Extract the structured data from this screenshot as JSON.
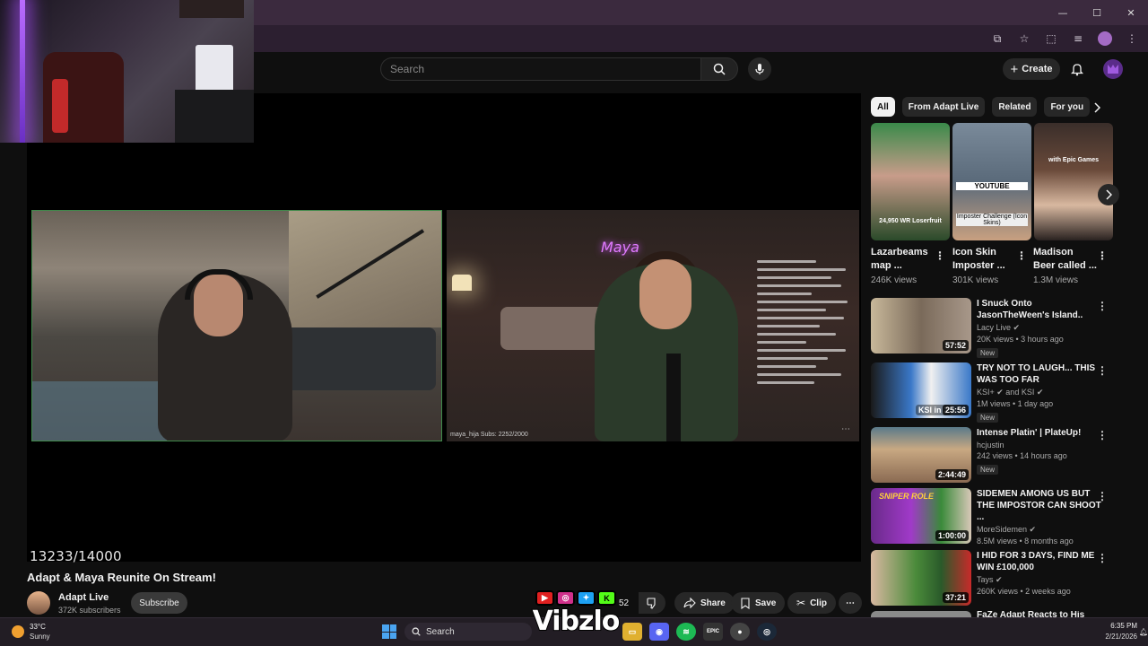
{
  "window": {
    "controls": [
      "—",
      "☐",
      "✕"
    ]
  },
  "header": {
    "search_placeholder": "Search",
    "create_label": "Create"
  },
  "player": {
    "counter": "13233/14000",
    "overlay_neon": "Maya",
    "overlay_handle": "maya_hija  Subs: 2252/2000"
  },
  "video": {
    "title": "Adapt & Maya Reunite On Stream!",
    "channel": "Adapt Live",
    "subscribers": "372K subscribers",
    "subscribe_label": "Subscribe",
    "like_count": "52",
    "share_label": "Share",
    "save_label": "Save",
    "clip_label": "Clip"
  },
  "watermark": {
    "text": "Vibzlo",
    "icons": [
      "youtube-icon",
      "instagram-icon",
      "twitter-icon",
      "kick-icon"
    ]
  },
  "sidebar": {
    "chips": [
      "All",
      "From Adapt Live",
      "Related",
      "For you"
    ],
    "shorts": [
      {
        "title": "Lazarbeams map ...",
        "views": "246K views",
        "caption": "24,950  WR Loserfruit",
        "bg": "#2a6a3a"
      },
      {
        "title": "Icon Skin Imposter ...",
        "views": "301K views",
        "caption": "YOUTUBE",
        "caption2": "Imposter Challenge (Icon Skins)",
        "bg": "#5a6a7a"
      },
      {
        "title": "Madison Beer called ...",
        "views": "1.3M views",
        "caption": "with Epic Games",
        "bg": "#4a3a34"
      }
    ],
    "recommendations": [
      {
        "title": "I Snuck Onto JasonTheWeen's Island..",
        "channel": "Lacy Live ✔",
        "meta": "20K views • 3 hours ago",
        "badge": "New",
        "duration": "57:52",
        "bg": "#7a7a6a"
      },
      {
        "title": "TRY NOT TO LAUGH... THIS WAS TOO FAR",
        "channel": "KSI+ ✔ and KSI ✔",
        "meta": "1M views • 1 day ago",
        "badge": "New",
        "duration": "25:56",
        "overlay": "KSI in 2",
        "bg": "#3a78c8"
      },
      {
        "title": "Intense Platin' | PlateUp!",
        "channel": "hcjustin",
        "meta": "242 views • 14 hours ago",
        "badge": "New",
        "duration": "2:44:49",
        "bg": "#8a6a52"
      },
      {
        "title": "SIDEMEN AMONG US BUT THE IMPOSTOR CAN SHOOT ...",
        "channel": "MoreSidemen ✔",
        "meta": "8.5M views • 8 months ago",
        "badge": "",
        "duration": "1:00:00",
        "overlay": "SNIPER ROLE",
        "bg": "#a03ac8"
      },
      {
        "title": "I HID FOR 3 DAYS, FIND ME WIN £100,000",
        "channel": "Tays ✔",
        "meta": "260K views • 2 weeks ago",
        "badge": "",
        "duration": "37:21",
        "bg": "#4a8a3a"
      },
      {
        "title": "FaZe Adapt Reacts to His",
        "channel": "",
        "meta": "",
        "badge": "",
        "duration": "",
        "bg": "#8a8a8a"
      }
    ]
  },
  "taskbar": {
    "temp": "33°C",
    "weather": "Sunny",
    "search_label": "Search",
    "time": "6:35 PM",
    "date": "2/21/2026",
    "app_icons": [
      {
        "name": "discord-icon",
        "glyph": "◉",
        "color": "#5865f2"
      },
      {
        "name": "spotify-icon",
        "glyph": "≋",
        "color": "#1db954"
      },
      {
        "name": "epic-games-icon",
        "glyph": "EPIC",
        "color": "#333"
      },
      {
        "name": "obs-icon",
        "glyph": "●",
        "color": "#444"
      },
      {
        "name": "steam-icon",
        "glyph": "◎",
        "color": "#1b2838"
      }
    ]
  }
}
